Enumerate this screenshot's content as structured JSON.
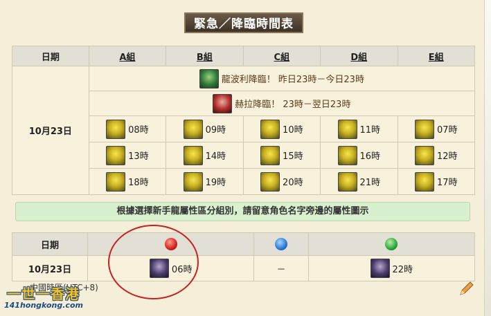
{
  "title": "緊急／降臨時間表",
  "schedule": {
    "headers": [
      "日期",
      "A組",
      "B組",
      "C組",
      "D組",
      "E組"
    ],
    "date": "10月23日",
    "events": [
      {
        "icon": "dragon-monster-icon",
        "text": "龍波利降臨！ 昨日23時－今日23時"
      },
      {
        "icon": "hera-monster-icon",
        "text": "赫拉降臨！ 23時－翌日23時"
      }
    ],
    "rows": [
      [
        "08時",
        "09時",
        "10時",
        "11時",
        "07時"
      ],
      [
        "13時",
        "14時",
        "15時",
        "16時",
        "12時"
      ],
      [
        "18時",
        "19時",
        "20時",
        "21時",
        "17時"
      ]
    ]
  },
  "notice": "根據選擇新手龍屬性區分組別，請留意角色名字旁邊的屬性圖示",
  "attribute_table": {
    "headers": [
      "日期"
    ],
    "date": "10月23日",
    "cells": [
      "06時",
      "－",
      "22時"
    ]
  },
  "timezone": "中國時區(UTC+8)",
  "watermark": {
    "line1": "一世一香港",
    "line2": "141hongkong.com"
  },
  "colors": {
    "highlight_circle": "#c8201e",
    "notice_bg": "#d9f0cf",
    "header_bg": "#e2dfd4",
    "cell_bg": "#f8f2dc"
  }
}
